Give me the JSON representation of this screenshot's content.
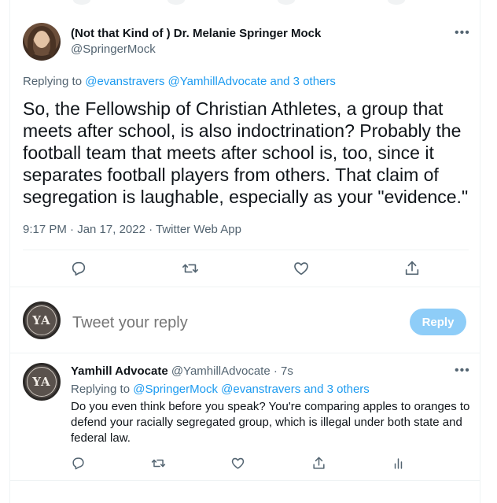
{
  "main_tweet": {
    "author_name": "(Not that Kind of ) Dr. Melanie Springer Mock",
    "author_handle": "@SpringerMock",
    "more_label": "•••",
    "replying_prefix": "Replying to",
    "replying_to": "@evanstravers @YamhillAdvocate and 3 others",
    "text": "So, the Fellowship of Christian Athletes, a group that meets after school, is also indoctrination? Probably the football team that meets after school is, too, since it separates football players from others. That claim of segregation is laughable, especially as your \"evidence.\"",
    "meta": "9:17 PM · Jan 17, 2022 · Twitter Web App"
  },
  "composer": {
    "avatar_text": "YA",
    "placeholder": "Tweet your reply",
    "reply_button": "Reply"
  },
  "reply_tweet": {
    "author_name": "Yamhill Advocate",
    "author_handle": "@YamhillAdvocate",
    "time": "· 7s",
    "avatar_text": "YA",
    "more_label": "•••",
    "replying_prefix": "Replying to",
    "replying_to": "@SpringerMock @evanstravers and 3 others",
    "text": "Do you even think before you speak? You're comparing apples to oranges to defend your racially segregated group, which is illegal under both state and federal law."
  },
  "colors": {
    "accent": "#1d9bf0",
    "reply_button_disabled": "#8ecdf8",
    "secondary_text": "#536471",
    "border": "#eff3f4"
  }
}
